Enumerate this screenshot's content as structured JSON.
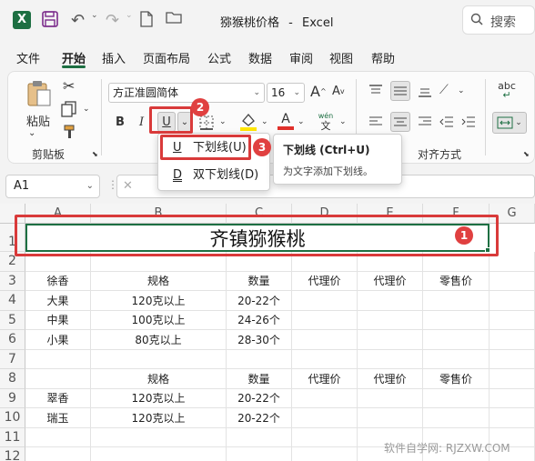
{
  "titlebar": {
    "app_icon": "X",
    "file_title": "猕猴桃价格",
    "app_name": "Excel",
    "title_sep": "-",
    "search_label": "搜索"
  },
  "menu": {
    "tabs": [
      "文件",
      "开始",
      "插入",
      "页面布局",
      "公式",
      "数据",
      "审阅",
      "视图",
      "帮助"
    ],
    "active": "开始"
  },
  "ribbon": {
    "clipboard": {
      "paste_label": "粘贴",
      "group_label": "剪贴板"
    },
    "font": {
      "font_name": "方正准圆简体",
      "font_size": "16",
      "grow_label": "A",
      "shrink_label": "A",
      "bold": "B",
      "italic": "I",
      "underline": "U",
      "font_color_letter": "A",
      "phonetic_top": "wén",
      "phonetic_bottom": "文",
      "highlight_color": "#ffe600",
      "font_color": "#e0302b"
    },
    "alignment": {
      "group_label": "对齐方式",
      "wrap_label": "ab",
      "wrap_sub": "c"
    }
  },
  "underline_menu": {
    "items": [
      {
        "icon": "U",
        "label": "下划线(U)"
      },
      {
        "icon": "D",
        "label": "双下划线(D)"
      }
    ]
  },
  "tooltip": {
    "heading": "下划线 (Ctrl+U)",
    "description": "为文字添加下划线。"
  },
  "formula_bar": {
    "name_box": "A1",
    "cancel": "✕",
    "formula": ""
  },
  "annotations": {
    "badge1": "1",
    "badge2": "2",
    "badge3": "3"
  },
  "sheet": {
    "columns": [
      "A",
      "B",
      "C",
      "D",
      "E",
      "F",
      "G"
    ],
    "rows": [
      "1",
      "2",
      "3",
      "4",
      "5",
      "6",
      "7",
      "8",
      "9",
      "10",
      "11",
      "12"
    ],
    "title": "齐镇猕猴桃",
    "cells": {
      "r3": [
        "徐香",
        "规格",
        "数量",
        "代理价",
        "代理价",
        "零售价"
      ],
      "r4": [
        "大果",
        "120克以上",
        "20-22个",
        "",
        "",
        ""
      ],
      "r5": [
        "中果",
        "100克以上",
        "24-26个",
        "",
        "",
        ""
      ],
      "r6": [
        "小果",
        "80克以上",
        "28-30个",
        "",
        "",
        ""
      ],
      "r8": [
        "",
        "规格",
        "数量",
        "代理价",
        "代理价",
        "零售价"
      ],
      "r9": [
        "翠香",
        "120克以上",
        "20-22个",
        "",
        "",
        ""
      ],
      "r10": [
        "瑞玉",
        "120克以上",
        "20-22个",
        "",
        "",
        ""
      ]
    }
  },
  "watermark": "软件自学网: RJZXW.COM",
  "colors": {
    "excel_green": "#1d6f42",
    "annotation_red": "#d93a3a"
  }
}
